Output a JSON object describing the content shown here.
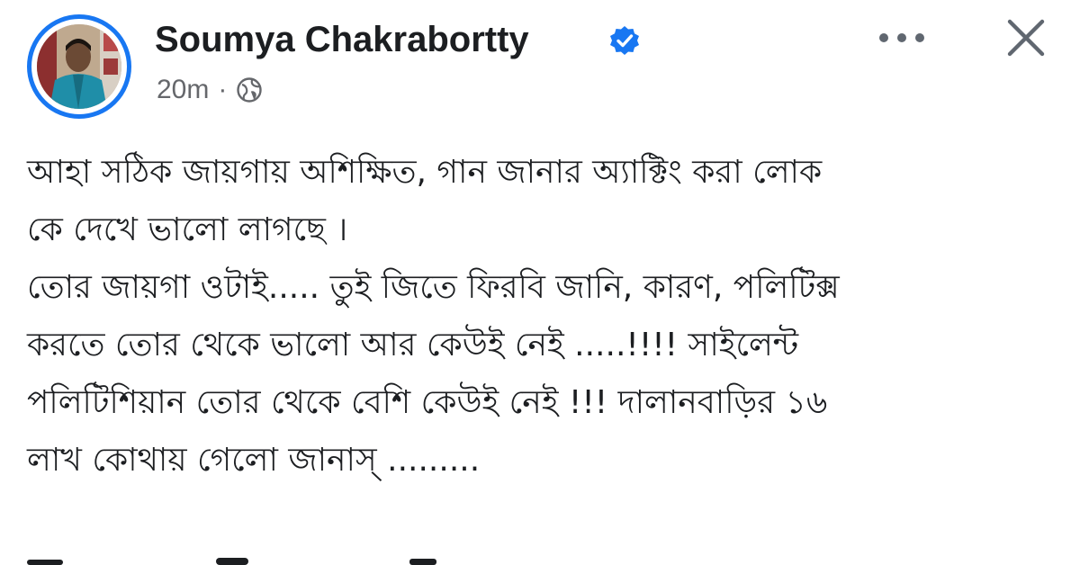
{
  "post": {
    "author_name": "Soumya Chakrabortty",
    "verified": true,
    "timestamp": "20m",
    "separator": "·",
    "privacy_icon": "globe-icon",
    "more_icon": "more-options-icon",
    "close_icon": "close-icon",
    "text_lines": [
      "আহা সঠিক জায়গায় অশিক্ষিত, গান জানার অ্যাক্টিং করা লোক",
      "কে দেখে ভালো লাগছে ।",
      "তোর জায়গা ওটাই..... তুই জিতে ফিরবি জানি, কারণ, পলিটিক্স",
      "করতে তোর থেকে ভালো আর কেউই নেই .....!!!! সাইলেন্ট",
      "পলিটিশিয়ান তোর থেকে বেশি কেউই নেই !!! দালানবাড়ির ১৬",
      "লাখ কোথায় গেলো জানাস্ ........."
    ]
  },
  "colors": {
    "accent": "#1877f2",
    "text_primary": "#1c1e21",
    "text_secondary": "#65676b",
    "icon_gray": "#606770"
  }
}
